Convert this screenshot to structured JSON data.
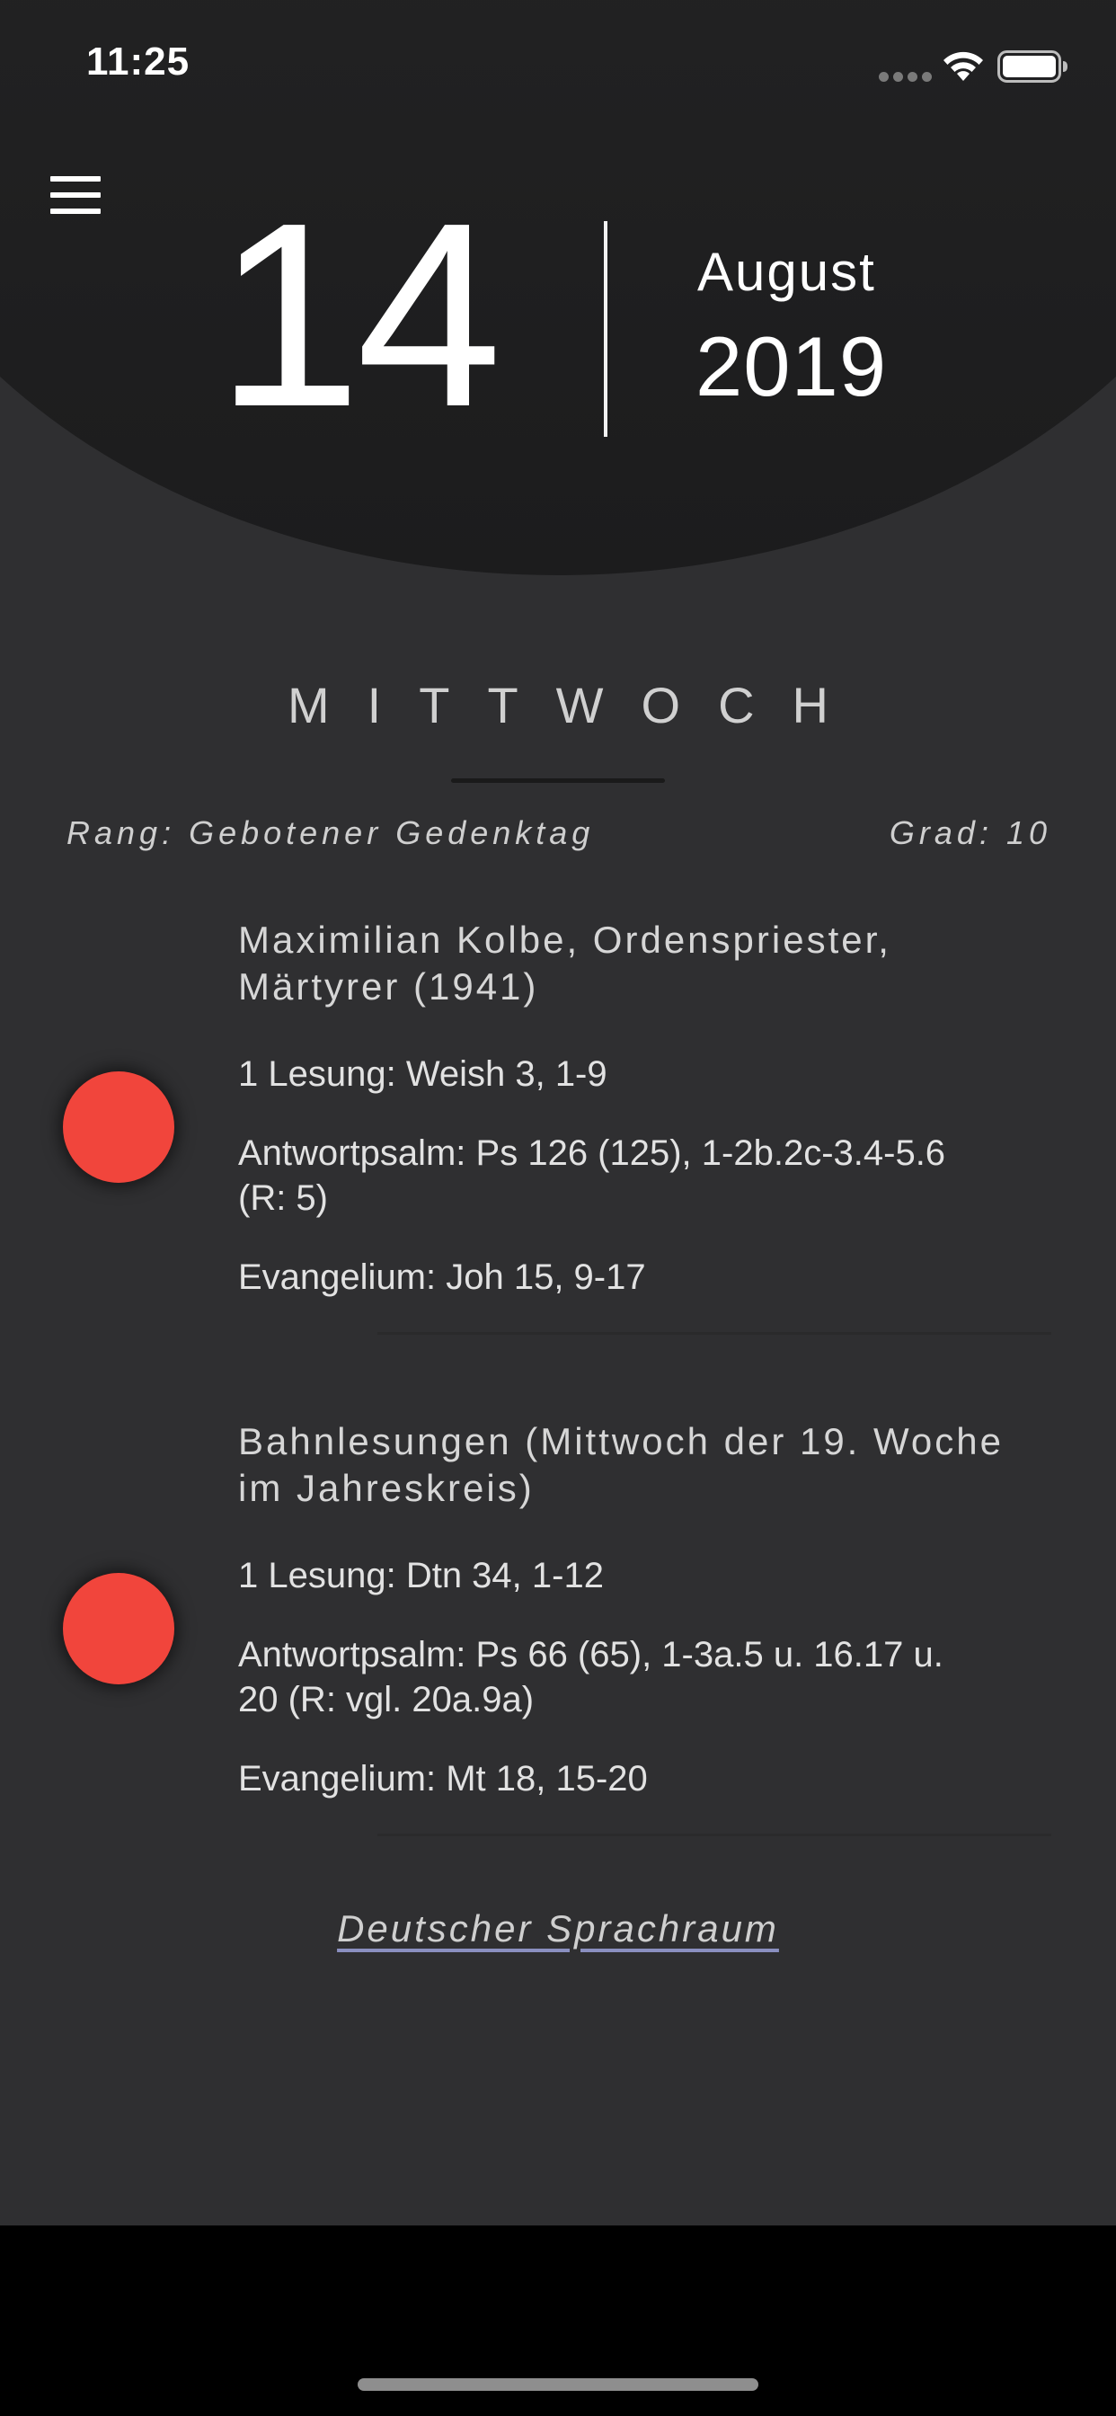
{
  "status_bar": {
    "time": "11:25"
  },
  "header": {
    "day": "14",
    "month": "August",
    "year": "2019"
  },
  "weekday": "MITTWOCH",
  "meta": {
    "rank": "Rang: Gebotener Gedenktag",
    "grade": "Grad: 10"
  },
  "readings": [
    {
      "title_line1": "Maximilian Kolbe, Ordenspriester,",
      "title_line2": "Märtyrer (1941)",
      "lesung": "1 Lesung: Weish 3, 1-9",
      "psalm_line1": "Antwortpsalm: Ps 126 (125), 1-2b.2c-3.4-5.6",
      "psalm_line2": "(R: 5)",
      "evangelium": "Evangelium: Joh 15, 9-17",
      "color": "#f1453c"
    },
    {
      "title_line1": "Bahnlesungen (Mittwoch der 19. Woche",
      "title_line2": "im Jahreskreis)",
      "lesung": "1 Lesung: Dtn 34, 1-12",
      "psalm_line1": "Antwortpsalm: Ps 66 (65), 1-3a.5 u. 16.17 u.",
      "psalm_line2": "20 (R: vgl. 20a.9a)",
      "evangelium": "Evangelium: Mt 18, 15-20",
      "color": "#f1453c"
    }
  ],
  "footer": {
    "link_label": "Deutscher Sprachraum"
  },
  "icons": {
    "menu": "hamburger-menu-icon",
    "wifi": "wifi-icon",
    "battery": "battery-icon",
    "signal": "cellular-signal-icon"
  }
}
